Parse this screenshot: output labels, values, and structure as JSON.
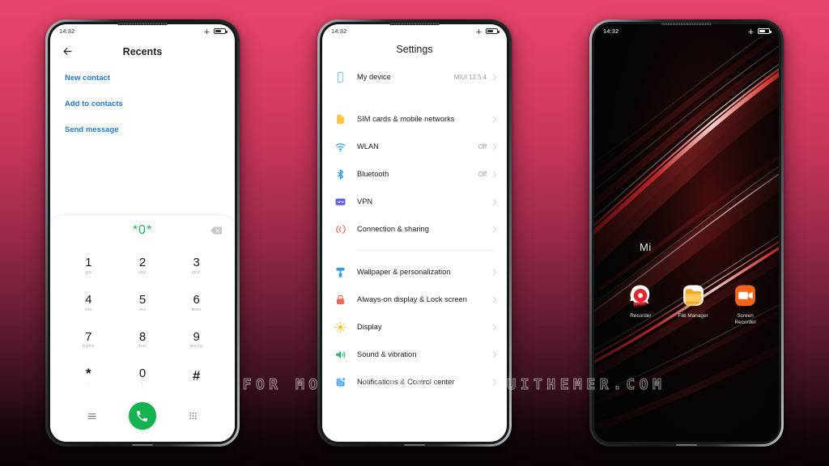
{
  "background": {
    "top_color": "#e8456c",
    "bottom_color": "#080305"
  },
  "watermark": {
    "text": "VISIT FOR MORE THEMES - MIUITHEMER.COM"
  },
  "statusbar": {
    "time": "14:32",
    "airplane_icon": "airplane-icon",
    "battery_icon": "battery-icon"
  },
  "phone1": {
    "header": {
      "back_icon": "back-arrow-icon",
      "title": "Recents"
    },
    "links": [
      {
        "label": "New contact"
      },
      {
        "label": "Add to contacts"
      },
      {
        "label": "Send message"
      }
    ],
    "dialer": {
      "number": "*0*",
      "backspace_icon": "backspace-icon",
      "keys": [
        {
          "digit": "1",
          "letters": "QD"
        },
        {
          "digit": "2",
          "letters": "ABC"
        },
        {
          "digit": "3",
          "letters": "DEF"
        },
        {
          "digit": "4",
          "letters": "GHI"
        },
        {
          "digit": "5",
          "letters": "JKL"
        },
        {
          "digit": "6",
          "letters": "MNO"
        },
        {
          "digit": "7",
          "letters": "PQRS"
        },
        {
          "digit": "8",
          "letters": "TUV"
        },
        {
          "digit": "9",
          "letters": "WXYZ"
        },
        {
          "digit": "*",
          "letters": ","
        },
        {
          "digit": "0",
          "letters": "+"
        },
        {
          "digit": "#",
          "letters": ""
        }
      ],
      "menu_icon": "menu-icon",
      "call_icon": "call-icon",
      "keypad_icon": "keypad-icon",
      "call_button_color": "#13b34f",
      "number_color": "#1fb365"
    }
  },
  "phone2": {
    "title": "Settings",
    "rows": [
      {
        "icon": "device-icon",
        "label": "My device",
        "value": "MIUI 12.5.4",
        "color": "#7ec8ef"
      },
      {
        "icon": "sim-card-icon",
        "label": "SIM cards & mobile networks",
        "value": "",
        "color": "#ffc53d"
      },
      {
        "icon": "wifi-icon",
        "label": "WLAN",
        "value": "Off",
        "color": "#3aa8e8"
      },
      {
        "icon": "bluetooth-icon",
        "label": "Bluetooth",
        "value": "Off",
        "color": "#2196f3"
      },
      {
        "icon": "vpn-icon",
        "label": "VPN",
        "value": "",
        "color": "#5a5ae6"
      },
      {
        "icon": "connection-icon",
        "label": "Connection & sharing",
        "value": "",
        "color": "#f06a5a"
      },
      {
        "icon": "wallpaper-icon",
        "label": "Wallpaper & personalization",
        "value": "",
        "color": "#2b9fe0"
      },
      {
        "icon": "lock-icon",
        "label": "Always-on display & Lock screen",
        "value": "",
        "color": "#f1685a"
      },
      {
        "icon": "display-icon",
        "label": "Display",
        "value": "",
        "color": "#fbc02d"
      },
      {
        "icon": "sound-icon",
        "label": "Sound & vibration",
        "value": "",
        "color": "#27b86e"
      },
      {
        "icon": "notifications-icon",
        "label": "Notifications & Control center",
        "value": "",
        "color": "#3aa0ef"
      }
    ]
  },
  "phone3": {
    "folder_label": "Mi",
    "apps": [
      {
        "name": "Recorder",
        "icon": "recorder-icon",
        "color": "#e8252c"
      },
      {
        "name": "File Manager",
        "icon": "file-manager-icon",
        "color": "#f5a623"
      },
      {
        "name": "Screen Recorder",
        "icon": "screen-recorder-icon",
        "color": "#f2651a"
      }
    ]
  }
}
